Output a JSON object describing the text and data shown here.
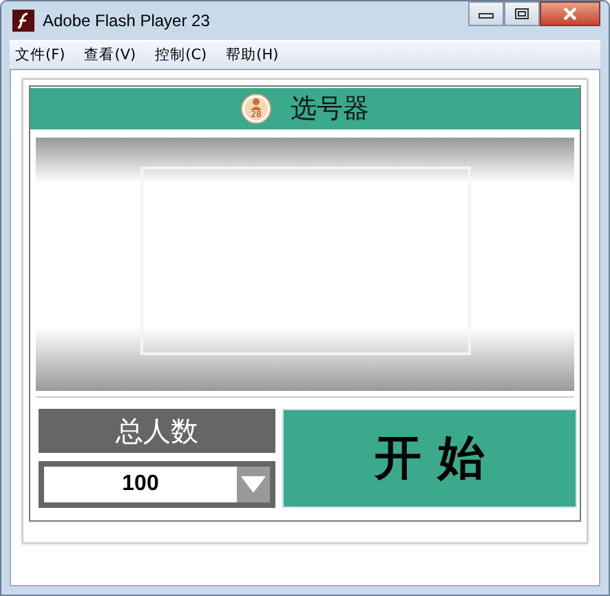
{
  "window": {
    "title": "Adobe Flash Player 23"
  },
  "menu": [
    {
      "label": "文件(F)"
    },
    {
      "label": "查看(V)"
    },
    {
      "label": "控制(C)"
    },
    {
      "label": "帮助(H)"
    }
  ],
  "header": {
    "title": "选号器",
    "badge": "28"
  },
  "total": {
    "label": "总人数",
    "value": "100"
  },
  "start_button": {
    "label": "开 始"
  }
}
